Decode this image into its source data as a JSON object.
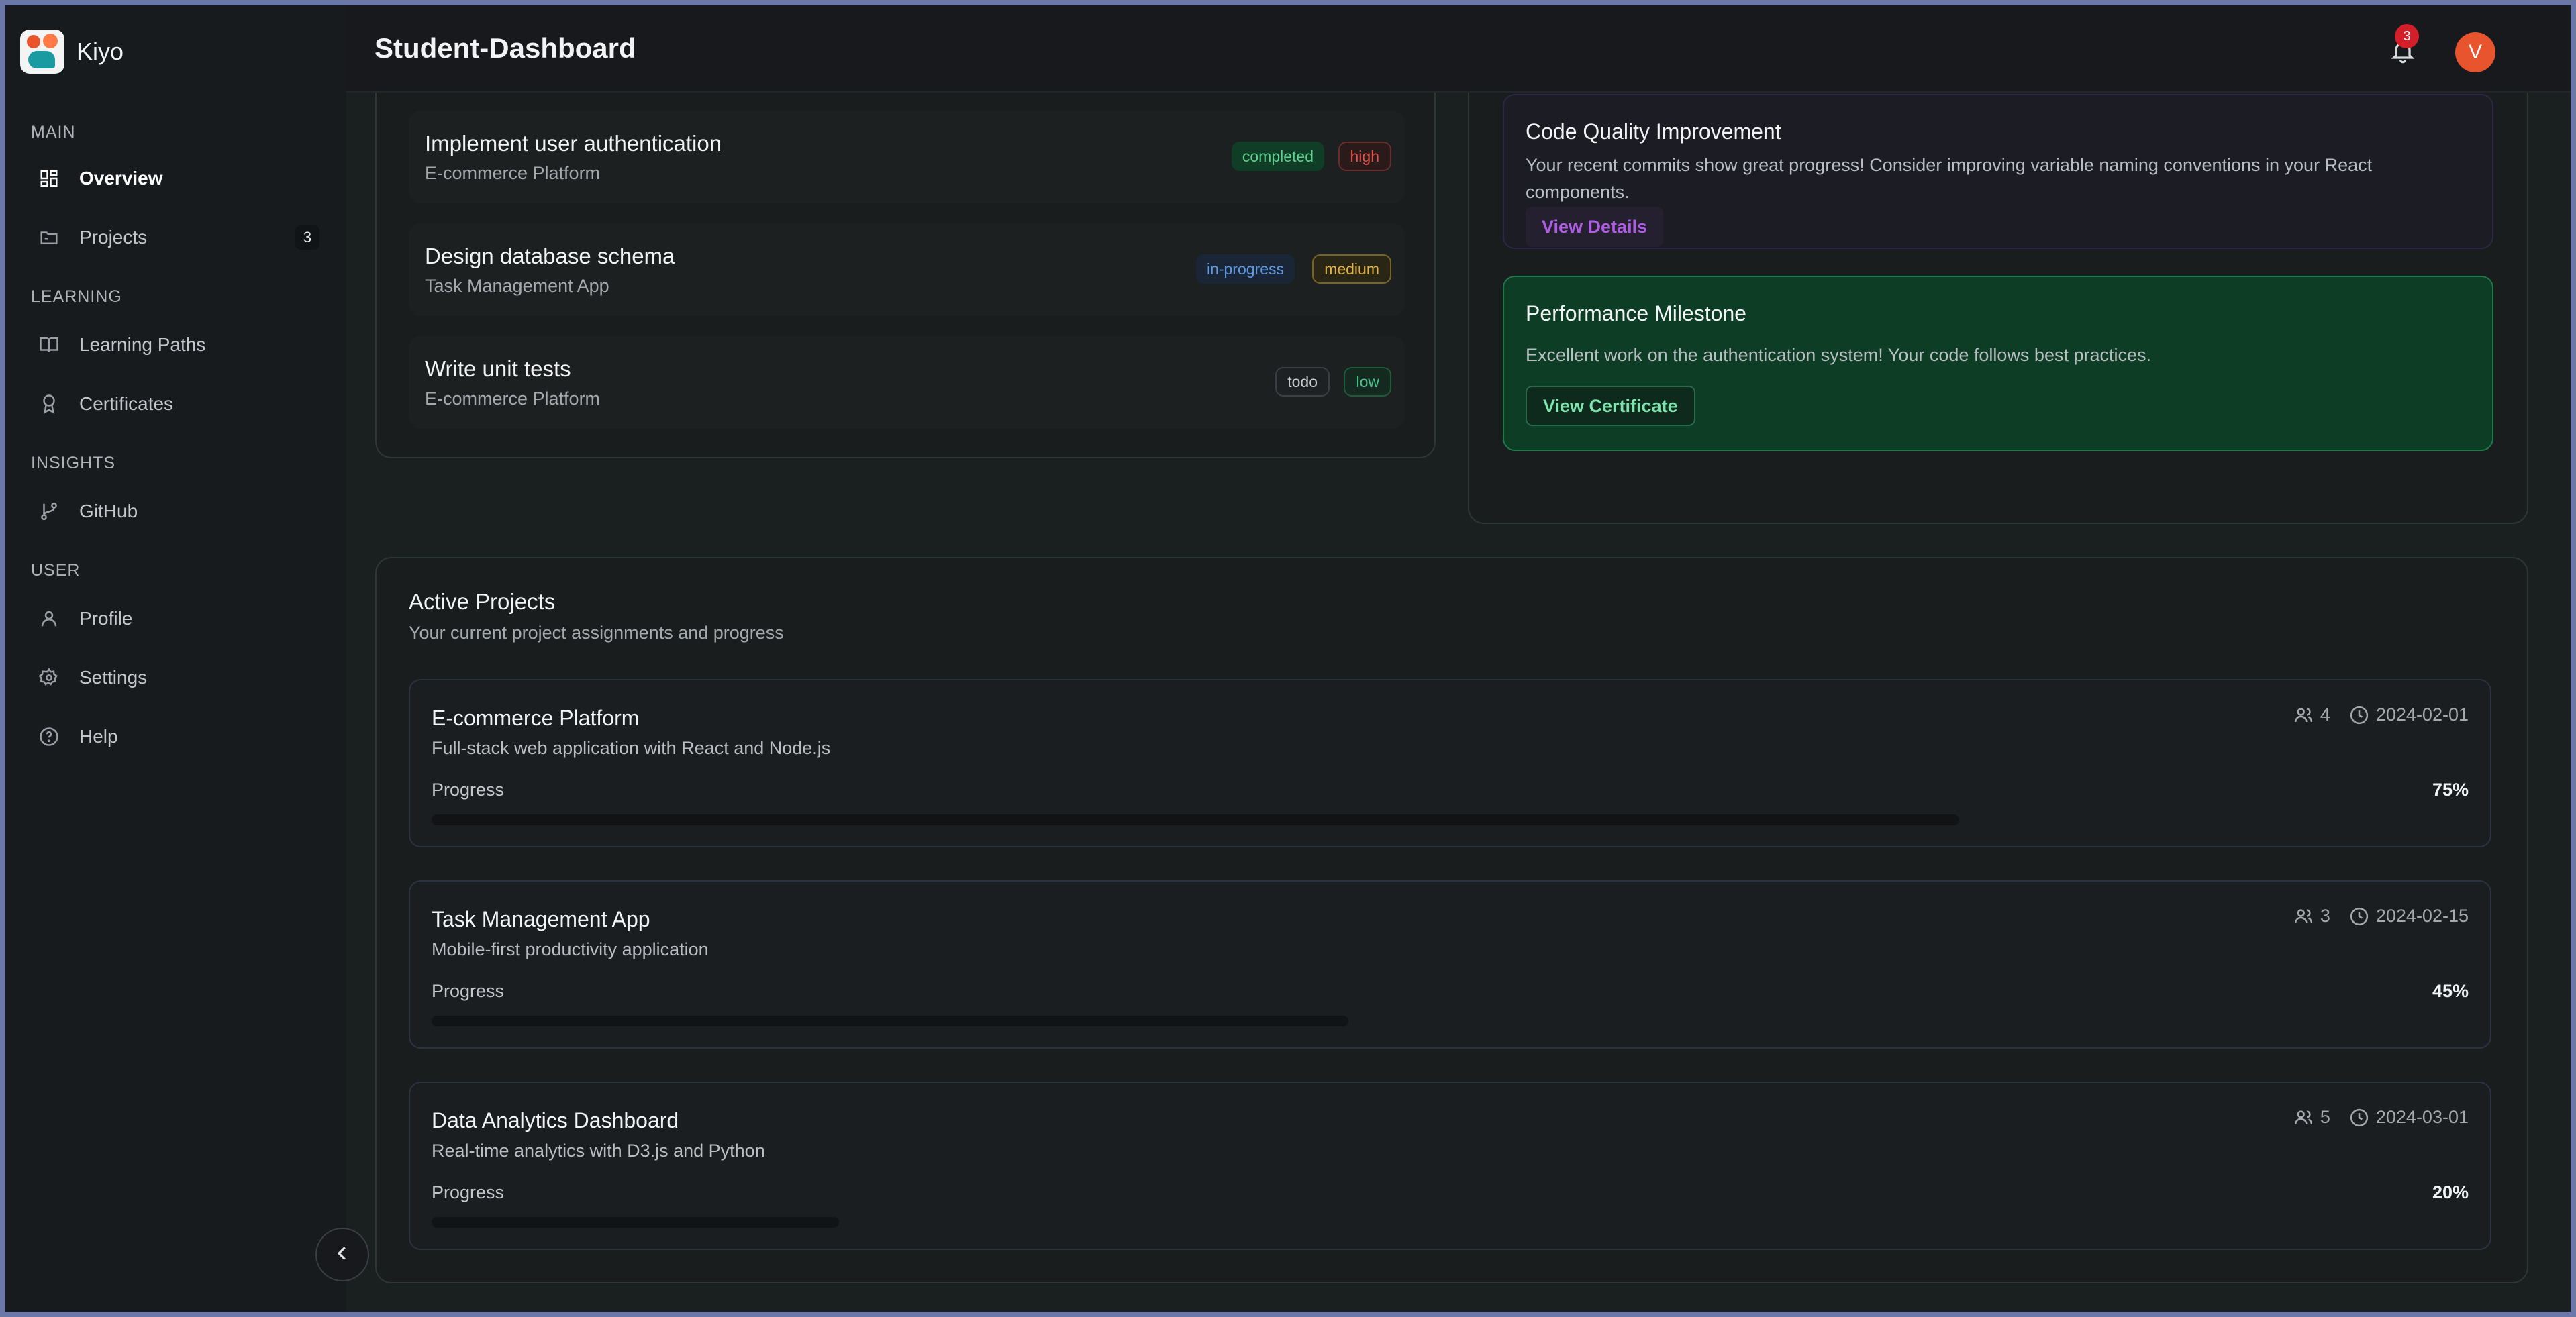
{
  "app": {
    "name": "Kiyo"
  },
  "header": {
    "title": "Student-Dashboard",
    "notification_count": "3",
    "avatar_initial": "V"
  },
  "sidebar": {
    "sections": [
      {
        "label": "MAIN"
      },
      {
        "label": "LEARNING"
      },
      {
        "label": "INSIGHTS"
      },
      {
        "label": "USER"
      }
    ],
    "items": [
      {
        "label": "Overview",
        "icon": "dashboard-icon"
      },
      {
        "label": "Projects",
        "icon": "folder-icon",
        "badge": "3"
      },
      {
        "label": "Learning Paths",
        "icon": "book-icon"
      },
      {
        "label": "Certificates",
        "icon": "award-icon"
      },
      {
        "label": "GitHub",
        "icon": "git-branch-icon"
      },
      {
        "label": "Profile",
        "icon": "user-icon"
      },
      {
        "label": "Settings",
        "icon": "gear-icon"
      },
      {
        "label": "Help",
        "icon": "help-icon"
      }
    ]
  },
  "tasks": [
    {
      "title": "Implement user authentication",
      "project": "E-commerce Platform",
      "status": "completed",
      "priority": "high"
    },
    {
      "title": "Design database schema",
      "project": "Task Management App",
      "status": "in-progress",
      "priority": "medium"
    },
    {
      "title": "Write unit tests",
      "project": "E-commerce Platform",
      "status": "todo",
      "priority": "low"
    }
  ],
  "feedback": [
    {
      "title": "Code Quality Improvement",
      "text": "Your recent commits show great progress! Consider improving variable naming conventions in your React components.",
      "action": "View Details"
    },
    {
      "title": "Performance Milestone",
      "text": "Excellent work on the authentication system! Your code follows best practices.",
      "action": "View Certificate"
    }
  ],
  "active_projects": {
    "title": "Active Projects",
    "subtitle": "Your current project assignments and progress",
    "progress_label": "Progress",
    "items": [
      {
        "name": "E-commerce Platform",
        "description": "Full-stack web application with React and Node.js",
        "members": "4",
        "due": "2024-02-01",
        "progress": 75,
        "progress_text": "75%"
      },
      {
        "name": "Task Management App",
        "description": "Mobile-first productivity application",
        "members": "3",
        "due": "2024-02-15",
        "progress": 45,
        "progress_text": "45%"
      },
      {
        "name": "Data Analytics Dashboard",
        "description": "Real-time analytics with D3.js and Python",
        "members": "5",
        "due": "2024-03-01",
        "progress": 20,
        "progress_text": "20%"
      }
    ]
  },
  "colors": {
    "completed": "#1f8a4a",
    "high": "#e5534b",
    "in_progress": "#4b8fe0",
    "medium": "#e3b341",
    "low": "#4cc38a",
    "accent_purple": "#b15ce6",
    "milestone_green": "#0f5132"
  }
}
